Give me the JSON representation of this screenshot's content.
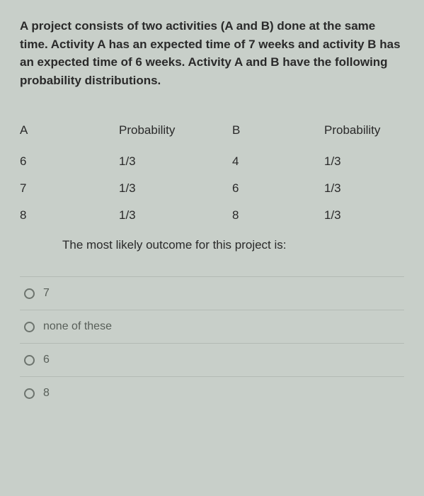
{
  "intro": "A project consists of two activities (A and B) done at the same time. Activity A has an expected time of 7 weeks and activity B has an expected time of 6 weeks. Activity A and B have the following probability distributions.",
  "table": {
    "headers": {
      "c1": "A",
      "c2": "Probability",
      "c3": "B",
      "c4": "Probability"
    },
    "rows": [
      {
        "c1": "6",
        "c2": "1/3",
        "c3": "4",
        "c4": "1/3"
      },
      {
        "c1": "7",
        "c2": "1/3",
        "c3": "6",
        "c4": "1/3"
      },
      {
        "c1": "8",
        "c2": "1/3",
        "c3": "8",
        "c4": "1/3"
      }
    ]
  },
  "question": "The most likely outcome for this project is:",
  "options": [
    {
      "label": "7"
    },
    {
      "label": "none of these"
    },
    {
      "label": "6"
    },
    {
      "label": "8"
    }
  ]
}
